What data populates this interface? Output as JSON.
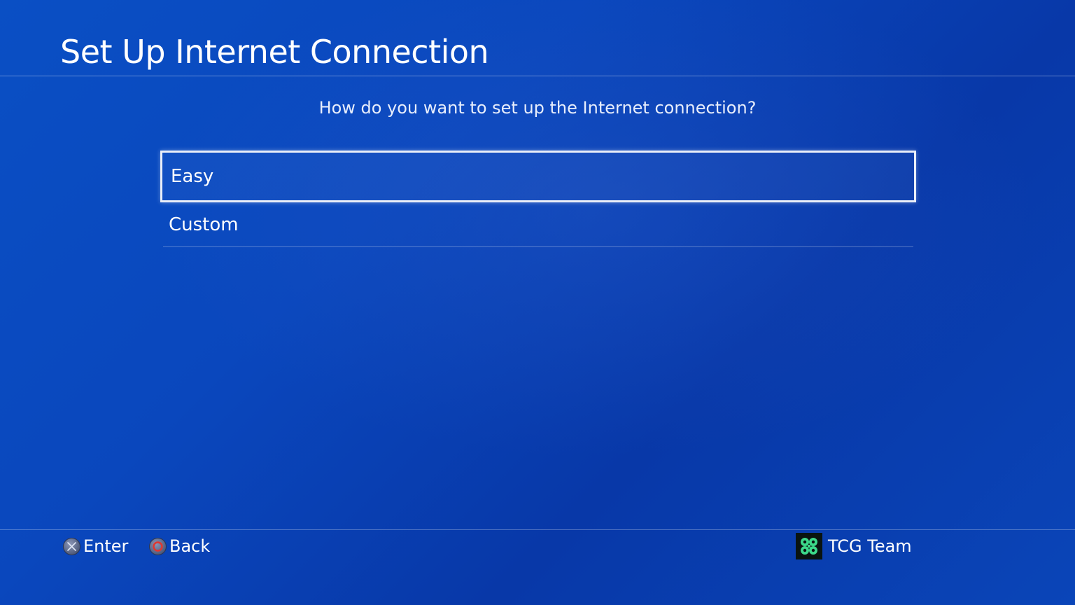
{
  "header": {
    "title": "Set Up Internet Connection"
  },
  "prompt": {
    "question": "How do you want to set up the Internet connection?"
  },
  "options": [
    {
      "label": "Easy",
      "selected": true
    },
    {
      "label": "Custom",
      "selected": false
    }
  ],
  "footer": {
    "hints": [
      {
        "icon": "cross-button-icon",
        "label": "Enter"
      },
      {
        "icon": "circle-button-icon",
        "label": "Back"
      }
    ],
    "user": {
      "avatar_icon": "clover-avatar-icon",
      "name": "TCG Team"
    }
  },
  "colors": {
    "background": "#0a47bd",
    "accent_green": "#3cd98a",
    "circle_red": "#e0362f"
  }
}
